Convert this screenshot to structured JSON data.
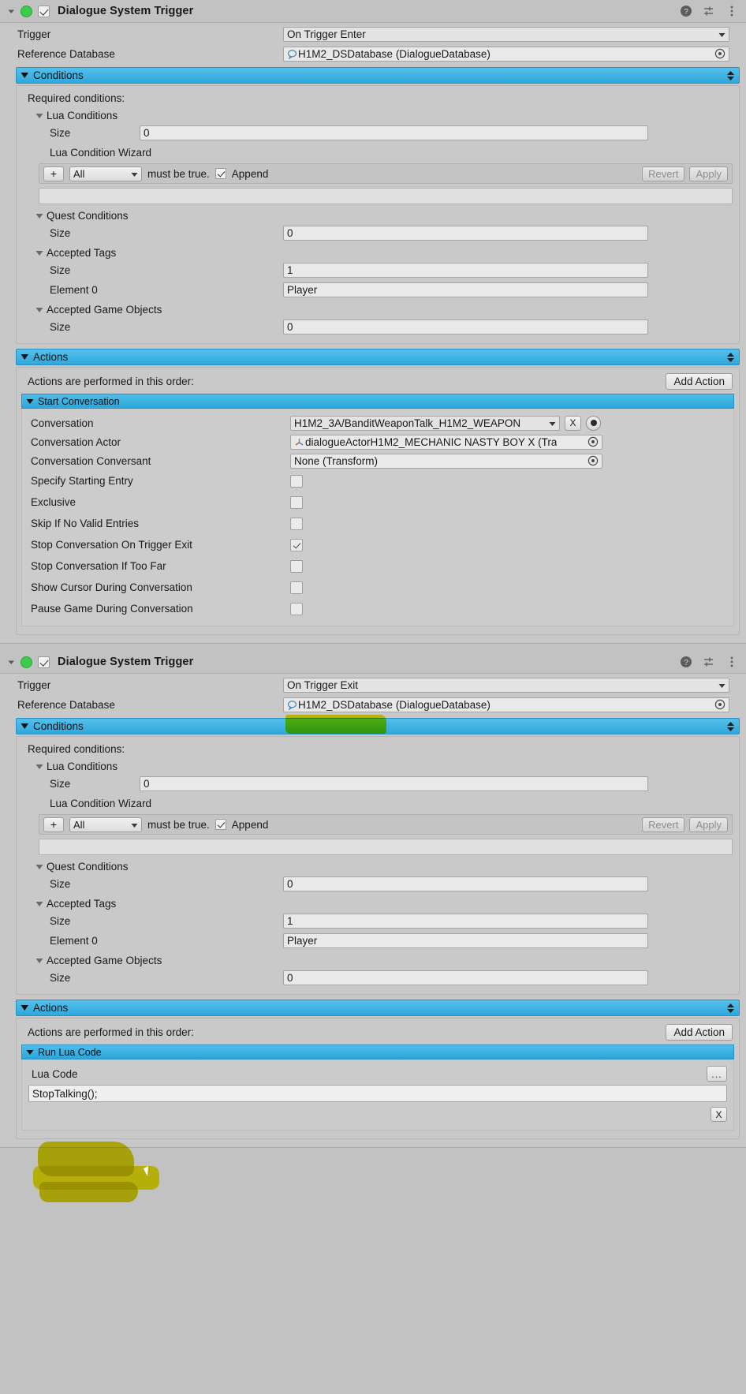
{
  "components": [
    {
      "id": "comp1",
      "title": "Dialogue System Trigger",
      "enabled": true,
      "header_icons": [
        "help-icon",
        "preset-icon",
        "more-menu-icon"
      ],
      "trigger": {
        "label": "Trigger",
        "value": "On Trigger Enter"
      },
      "reference_database": {
        "label": "Reference Database",
        "value": "H1M2_DSDatabase (DialogueDatabase)"
      },
      "conditions": {
        "section_label": "Conditions",
        "required_label": "Required conditions:",
        "lua_conditions": {
          "label": "Lua Conditions",
          "size_label": "Size",
          "size_value": "0"
        },
        "wizard": {
          "label": "Lua Condition Wizard",
          "plus": "+",
          "mode": "All",
          "must_be_true": "must be true.",
          "append_label": "Append",
          "append_checked": true,
          "revert": "Revert",
          "apply": "Apply"
        },
        "quest_conditions": {
          "label": "Quest Conditions",
          "size_label": "Size",
          "size_value": "0"
        },
        "accepted_tags": {
          "label": "Accepted Tags",
          "size_label": "Size",
          "size_value": "1",
          "element_label": "Element 0",
          "element_value": "Player"
        },
        "accepted_game_objects": {
          "label": "Accepted Game Objects",
          "size_label": "Size",
          "size_value": "0"
        }
      },
      "actions": {
        "section_label": "Actions",
        "order_label": "Actions are performed in this order:",
        "add_action_label": "Add Action",
        "action_title": "Start Conversation",
        "conversation": {
          "label": "Conversation",
          "value": "H1M2_3A/BanditWeaponTalk_H1M2_WEAPON",
          "clear": "X"
        },
        "conversation_actor": {
          "label": "Conversation Actor",
          "value": "dialogueActorH1M2_MECHANIC NASTY BOY X (Tra"
        },
        "conversation_conversant": {
          "label": "Conversation Conversant",
          "value": "None (Transform)"
        },
        "toggles": [
          {
            "label": "Specify Starting Entry",
            "checked": false
          },
          {
            "label": "Exclusive",
            "checked": false
          },
          {
            "label": "Skip If No Valid Entries",
            "checked": false
          },
          {
            "label": "Stop Conversation On Trigger Exit",
            "checked": true
          },
          {
            "label": "Stop Conversation If Too Far",
            "checked": false
          },
          {
            "label": "Show Cursor During Conversation",
            "checked": false
          },
          {
            "label": "Pause Game During Conversation",
            "checked": false
          }
        ]
      }
    },
    {
      "id": "comp2",
      "title": "Dialogue System Trigger",
      "enabled": true,
      "header_icons": [
        "help-icon",
        "preset-icon",
        "more-menu-icon"
      ],
      "trigger": {
        "label": "Trigger",
        "value": "On Trigger Exit",
        "highlighted": true
      },
      "reference_database": {
        "label": "Reference Database",
        "value": "H1M2_DSDatabase (DialogueDatabase)"
      },
      "conditions": {
        "section_label": "Conditions",
        "required_label": "Required conditions:",
        "lua_conditions": {
          "label": "Lua Conditions",
          "size_label": "Size",
          "size_value": "0"
        },
        "wizard": {
          "label": "Lua Condition Wizard",
          "plus": "+",
          "mode": "All",
          "must_be_true": "must be true.",
          "append_label": "Append",
          "append_checked": true,
          "revert": "Revert",
          "apply": "Apply"
        },
        "quest_conditions": {
          "label": "Quest Conditions",
          "size_label": "Size",
          "size_value": "0"
        },
        "accepted_tags": {
          "label": "Accepted Tags",
          "size_label": "Size",
          "size_value": "1",
          "element_label": "Element 0",
          "element_value": "Player"
        },
        "accepted_game_objects": {
          "label": "Accepted Game Objects",
          "size_label": "Size",
          "size_value": "0"
        }
      },
      "actions": {
        "section_label": "Actions",
        "order_label": "Actions are performed in this order:",
        "add_action_label": "Add Action",
        "action_title": "Run Lua Code",
        "lua_code": {
          "label": "Lua Code",
          "value": "StopTalking();",
          "browse": "...",
          "remove": "X",
          "highlighted": true
        }
      }
    }
  ],
  "colors": {
    "section_header": "#2fa8dc",
    "panel_bg": "#c8c8c8",
    "highlight": "#e9e312",
    "enabled_dot": "#3dcb4b"
  }
}
